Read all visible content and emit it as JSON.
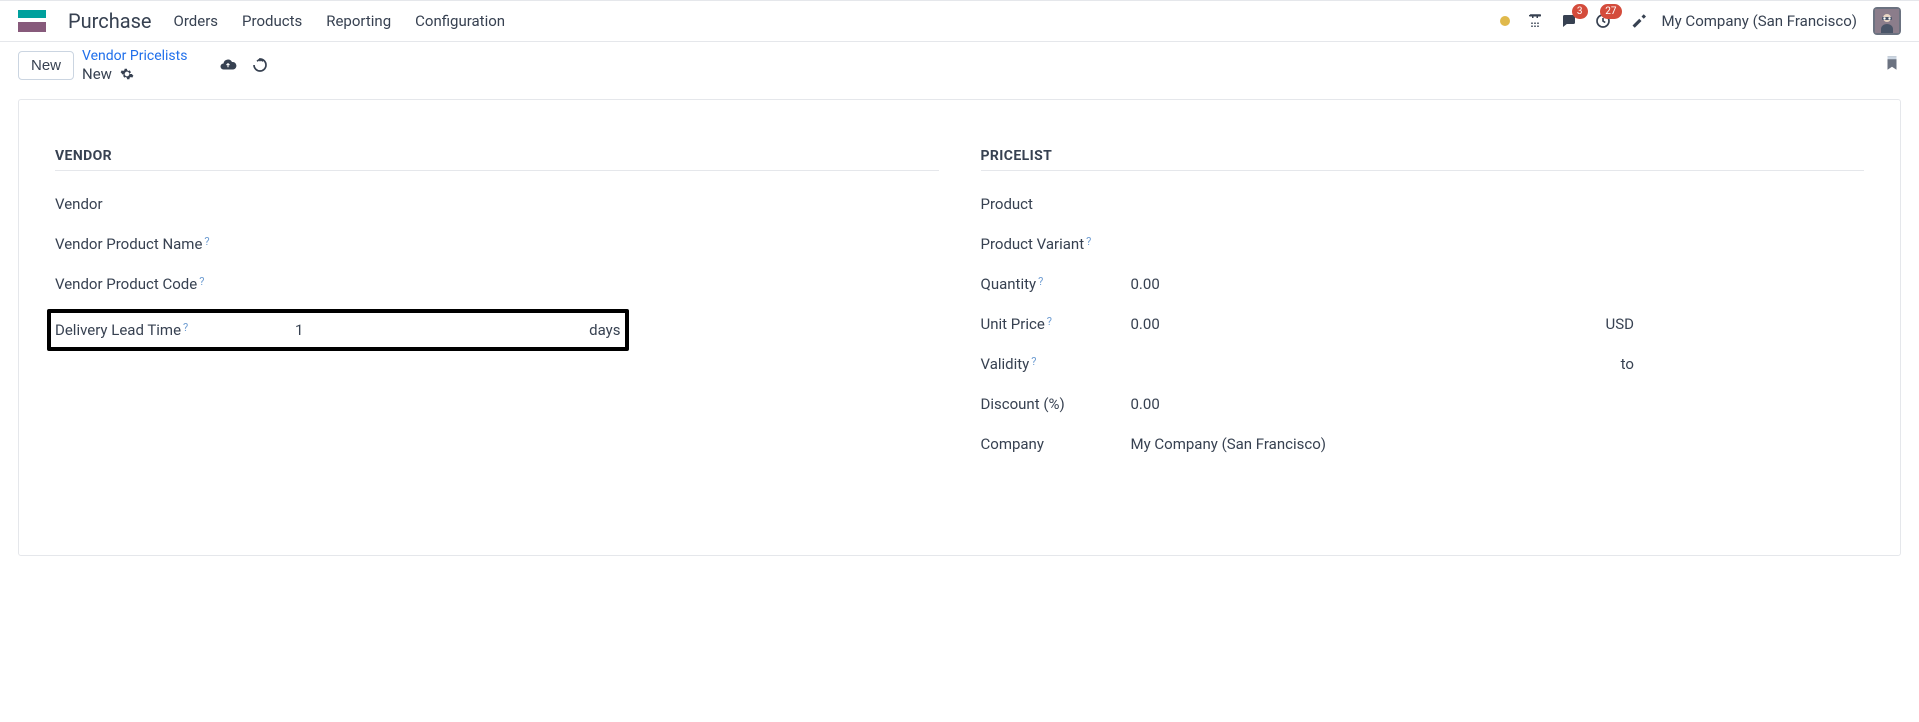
{
  "header": {
    "app_title": "Purchase",
    "menu": [
      "Orders",
      "Products",
      "Reporting",
      "Configuration"
    ],
    "messages_badge": "3",
    "activities_badge": "27",
    "company": "My Company (San Francisco)"
  },
  "breadcrumb": {
    "new_button": "New",
    "parent": "Vendor Pricelists",
    "current": "New"
  },
  "form": {
    "vendor": {
      "section_title": "VENDOR",
      "labels": {
        "vendor": "Vendor",
        "vendor_product_name": "Vendor Product Name",
        "vendor_product_code": "Vendor Product Code",
        "delivery_lead_time": "Delivery Lead Time"
      },
      "values": {
        "delivery_lead_time": "1",
        "delivery_lead_time_unit": "days"
      }
    },
    "pricelist": {
      "section_title": "PRICELIST",
      "labels": {
        "product": "Product",
        "product_variant": "Product Variant",
        "quantity": "Quantity",
        "unit_price": "Unit Price",
        "validity": "Validity",
        "discount": "Discount (%)",
        "company": "Company"
      },
      "values": {
        "quantity": "0.00",
        "unit_price": "0.00",
        "unit_price_currency": "USD",
        "validity_to": "to",
        "discount": "0.00",
        "company": "My Company (San Francisco)"
      }
    }
  },
  "help_marker": "?"
}
